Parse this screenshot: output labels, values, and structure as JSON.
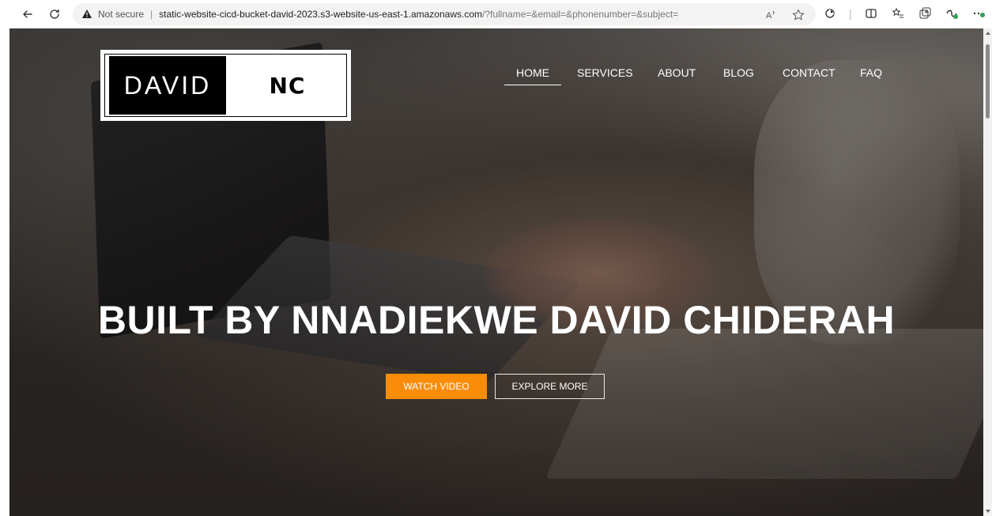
{
  "browser": {
    "security_label": "Not secure",
    "separator": "|",
    "url_host": "static-website-cicd-bucket-david-2023.s3-website-us-east-1.amazonaws.com",
    "url_query": "/?fullname=&email=&phonenumber=&subject=",
    "icons": [
      "back-arrow-icon",
      "reload-icon",
      "warning-icon",
      "read-aloud-icon",
      "favorite-star-icon",
      "extensions-icon",
      "split-screen-icon",
      "favorites-icon",
      "collections-icon",
      "copilot-icon",
      "more-icon"
    ]
  },
  "logo": {
    "left_text": "DAVID",
    "right_text": "NC"
  },
  "nav": {
    "items": [
      {
        "label": "HOME",
        "active": true
      },
      {
        "label": "SERVICES",
        "active": false
      },
      {
        "label": "ABOUT",
        "active": false
      },
      {
        "label": "BLOG",
        "active": false
      },
      {
        "label": "CONTACT",
        "active": false
      },
      {
        "label": "FAQ",
        "active": false
      }
    ]
  },
  "hero": {
    "title": "BUILT BY NNADIEKWE DAVID CHIDERAH",
    "primary_button": "WATCH VIDEO",
    "secondary_button": "EXPLORE MORE"
  },
  "colors": {
    "accent": "#f98d0a"
  }
}
